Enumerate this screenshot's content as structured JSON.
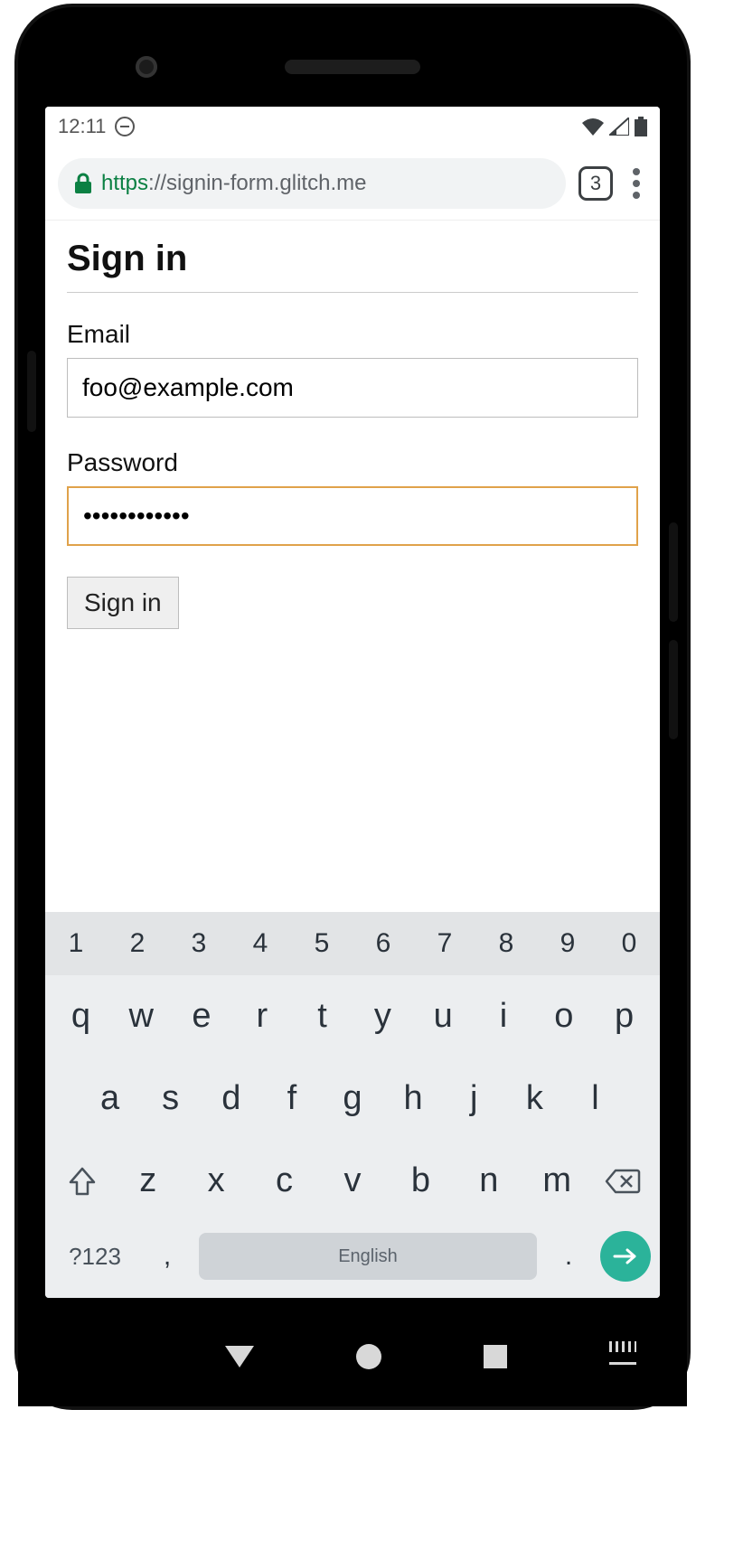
{
  "status_bar": {
    "time": "12:11"
  },
  "browser": {
    "scheme": "https",
    "sep": "://",
    "host_path": "signin-form.glitch.me",
    "tab_count": "3"
  },
  "page": {
    "title": "Sign in",
    "email_label": "Email",
    "email_value": "foo@example.com",
    "password_label": "Password",
    "password_value": "••••••••••••",
    "submit_label": "Sign in"
  },
  "keyboard": {
    "numbers": [
      "1",
      "2",
      "3",
      "4",
      "5",
      "6",
      "7",
      "8",
      "9",
      "0"
    ],
    "row1": [
      "q",
      "w",
      "e",
      "r",
      "t",
      "y",
      "u",
      "i",
      "o",
      "p"
    ],
    "row2": [
      "a",
      "s",
      "d",
      "f",
      "g",
      "h",
      "j",
      "k",
      "l"
    ],
    "row3": [
      "z",
      "x",
      "c",
      "v",
      "b",
      "n",
      "m"
    ],
    "symbols_key": "?123",
    "comma": ",",
    "period": ".",
    "space_label": "English"
  }
}
